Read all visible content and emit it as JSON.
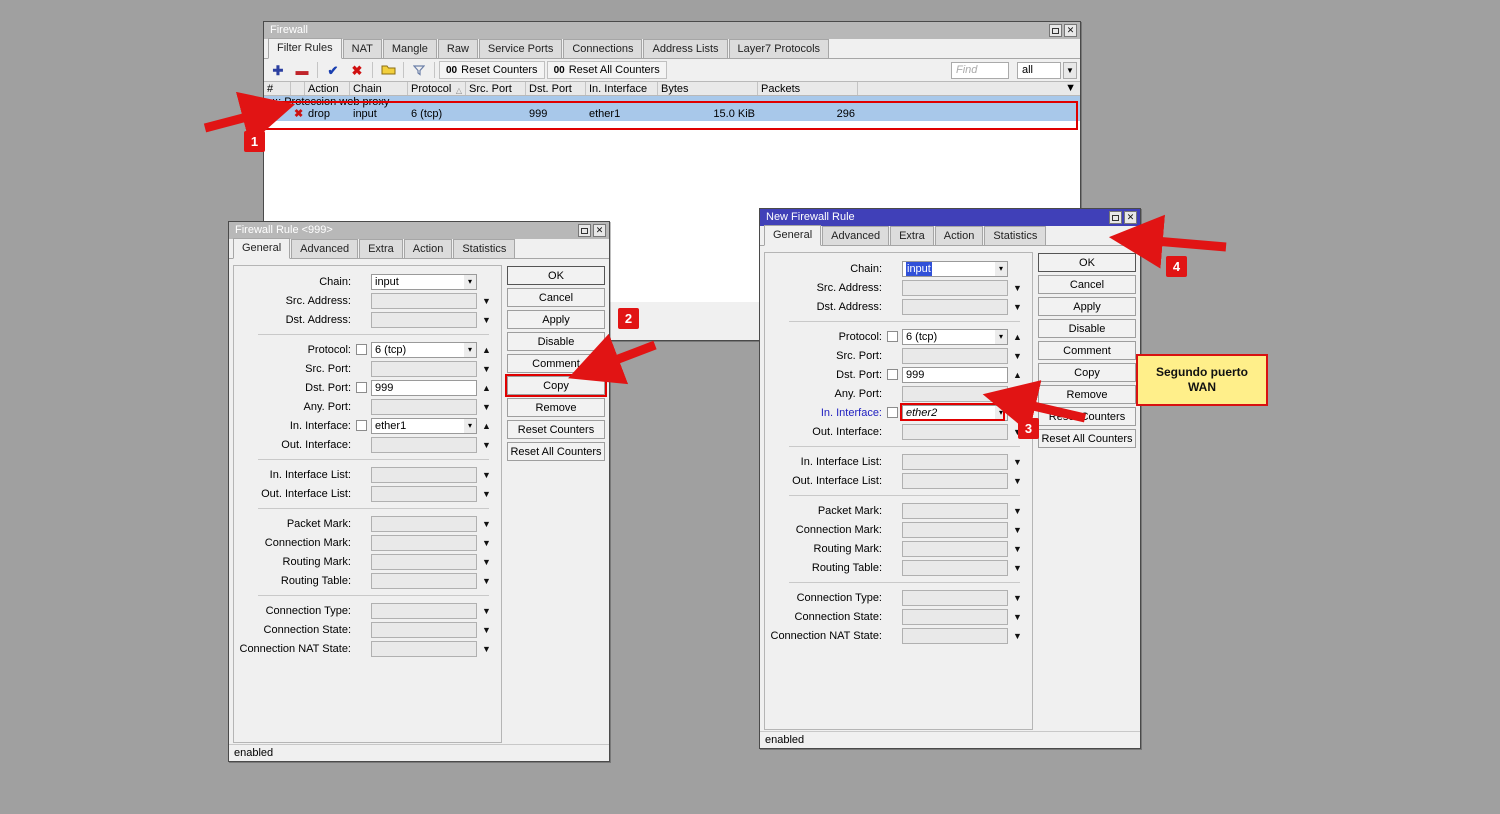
{
  "firewall_window": {
    "title": "Firewall",
    "window_buttons": [
      "maximize-icon",
      "close-icon"
    ],
    "tabs": [
      {
        "label": "Filter Rules",
        "selected": true
      },
      {
        "label": "NAT",
        "selected": false
      },
      {
        "label": "Mangle",
        "selected": false
      },
      {
        "label": "Raw",
        "selected": false
      },
      {
        "label": "Service Ports",
        "selected": false
      },
      {
        "label": "Connections",
        "selected": false
      },
      {
        "label": "Address Lists",
        "selected": false
      },
      {
        "label": "Layer7 Protocols",
        "selected": false
      }
    ],
    "toolbar": {
      "icons": [
        "add-icon",
        "remove-icon",
        "enable-icon",
        "disable-icon",
        "comment-icon",
        "filter-icon"
      ],
      "reset_counters_label": "Reset Counters",
      "reset_all_counters_label": "Reset All Counters",
      "counter_prefix": "00",
      "find_placeholder": "Find",
      "filter_value": "all"
    },
    "columns": [
      "#",
      "Action",
      "Chain",
      "Protocol",
      "Src. Port",
      "Dst. Port",
      "In. Interface",
      "Bytes",
      "Packets"
    ],
    "comment_row": ";;; Proteccion web proxy",
    "rows": [
      {
        "num": "0",
        "action": "drop",
        "chain": "input",
        "protocol": "6 (tcp)",
        "src_port": "",
        "dst_port": "999",
        "in_interface": "ether1",
        "bytes": "15.0 KiB",
        "packets": "296"
      }
    ]
  },
  "left_dialog": {
    "title": "Firewall Rule <999>",
    "tabs": [
      {
        "label": "General",
        "selected": true
      },
      {
        "label": "Advanced",
        "selected": false
      },
      {
        "label": "Extra",
        "selected": false
      },
      {
        "label": "Action",
        "selected": false
      },
      {
        "label": "Statistics",
        "selected": false
      }
    ],
    "fields": [
      {
        "label": "Chain:",
        "value": "input",
        "checkbox": false,
        "drop": "spin",
        "arrow": "none",
        "dim": false,
        "modified": false
      },
      {
        "label": "Src. Address:",
        "value": "",
        "checkbox": false,
        "drop": "none",
        "arrow": "down",
        "dim": true,
        "modified": false
      },
      {
        "label": "Dst. Address:",
        "value": "",
        "checkbox": false,
        "drop": "none",
        "arrow": "down",
        "dim": true,
        "modified": false
      },
      {
        "sep": true
      },
      {
        "label": "Protocol:",
        "value": "6 (tcp)",
        "checkbox": true,
        "drop": "spin",
        "arrow": "up",
        "dim": false,
        "modified": false
      },
      {
        "label": "Src. Port:",
        "value": "",
        "checkbox": false,
        "drop": "none",
        "arrow": "down",
        "dim": true,
        "modified": false
      },
      {
        "label": "Dst. Port:",
        "value": "999",
        "checkbox": true,
        "drop": "none",
        "arrow": "up",
        "dim": false,
        "modified": false
      },
      {
        "label": "Any. Port:",
        "value": "",
        "checkbox": false,
        "drop": "none",
        "arrow": "down",
        "dim": true,
        "modified": false
      },
      {
        "label": "In. Interface:",
        "value": "ether1",
        "checkbox": true,
        "drop": "spin",
        "arrow": "up",
        "dim": false,
        "modified": false
      },
      {
        "label": "Out. Interface:",
        "value": "",
        "checkbox": false,
        "drop": "none",
        "arrow": "down",
        "dim": true,
        "modified": false
      },
      {
        "sep": true
      },
      {
        "label": "In. Interface List:",
        "value": "",
        "checkbox": false,
        "drop": "none",
        "arrow": "down",
        "dim": true,
        "modified": false
      },
      {
        "label": "Out. Interface List:",
        "value": "",
        "checkbox": false,
        "drop": "none",
        "arrow": "down",
        "dim": true,
        "modified": false
      },
      {
        "sep": true
      },
      {
        "label": "Packet Mark:",
        "value": "",
        "checkbox": false,
        "drop": "none",
        "arrow": "down",
        "dim": true,
        "modified": false
      },
      {
        "label": "Connection Mark:",
        "value": "",
        "checkbox": false,
        "drop": "none",
        "arrow": "down",
        "dim": true,
        "modified": false
      },
      {
        "label": "Routing Mark:",
        "value": "",
        "checkbox": false,
        "drop": "none",
        "arrow": "down",
        "dim": true,
        "modified": false
      },
      {
        "label": "Routing Table:",
        "value": "",
        "checkbox": false,
        "drop": "none",
        "arrow": "down",
        "dim": true,
        "modified": false
      },
      {
        "sep": true
      },
      {
        "label": "Connection Type:",
        "value": "",
        "checkbox": false,
        "drop": "none",
        "arrow": "down",
        "dim": true,
        "modified": false
      },
      {
        "label": "Connection State:",
        "value": "",
        "checkbox": false,
        "drop": "none",
        "arrow": "down",
        "dim": true,
        "modified": false
      },
      {
        "label": "Connection NAT State:",
        "value": "",
        "checkbox": false,
        "drop": "none",
        "arrow": "down",
        "dim": true,
        "modified": false
      }
    ],
    "buttons": [
      "OK",
      "Cancel",
      "Apply",
      "Disable",
      "Comment",
      "Copy",
      "Remove",
      "Reset Counters",
      "Reset All Counters"
    ],
    "highlighted_button": "Copy",
    "status": "enabled"
  },
  "right_dialog": {
    "title": "New Firewall Rule",
    "tabs": [
      {
        "label": "General",
        "selected": true
      },
      {
        "label": "Advanced",
        "selected": false
      },
      {
        "label": "Extra",
        "selected": false
      },
      {
        "label": "Action",
        "selected": false
      },
      {
        "label": "Statistics",
        "selected": false
      }
    ],
    "fields": [
      {
        "label": "Chain:",
        "value": "input",
        "checkbox": false,
        "drop": "spin",
        "arrow": "none",
        "dim": false,
        "modified": false,
        "selected_text": true
      },
      {
        "label": "Src. Address:",
        "value": "",
        "checkbox": false,
        "drop": "none",
        "arrow": "down",
        "dim": true,
        "modified": false
      },
      {
        "label": "Dst. Address:",
        "value": "",
        "checkbox": false,
        "drop": "none",
        "arrow": "down",
        "dim": true,
        "modified": false
      },
      {
        "sep": true
      },
      {
        "label": "Protocol:",
        "value": "6 (tcp)",
        "checkbox": true,
        "drop": "spin",
        "arrow": "up",
        "dim": false,
        "modified": false
      },
      {
        "label": "Src. Port:",
        "value": "",
        "checkbox": false,
        "drop": "none",
        "arrow": "down",
        "dim": true,
        "modified": false
      },
      {
        "label": "Dst. Port:",
        "value": "999",
        "checkbox": true,
        "drop": "none",
        "arrow": "up",
        "dim": false,
        "modified": false
      },
      {
        "label": "Any. Port:",
        "value": "",
        "checkbox": false,
        "drop": "none",
        "arrow": "down",
        "dim": true,
        "modified": false
      },
      {
        "label": "In. Interface:",
        "value": "ether2",
        "checkbox": true,
        "drop": "spin",
        "arrow": "up",
        "dim": false,
        "modified": true,
        "highlight": true
      },
      {
        "label": "Out. Interface:",
        "value": "",
        "checkbox": false,
        "drop": "none",
        "arrow": "down",
        "dim": true,
        "modified": false
      },
      {
        "sep": true
      },
      {
        "label": "In. Interface List:",
        "value": "",
        "checkbox": false,
        "drop": "none",
        "arrow": "down",
        "dim": true,
        "modified": false
      },
      {
        "label": "Out. Interface List:",
        "value": "",
        "checkbox": false,
        "drop": "none",
        "arrow": "down",
        "dim": true,
        "modified": false
      },
      {
        "sep": true
      },
      {
        "label": "Packet Mark:",
        "value": "",
        "checkbox": false,
        "drop": "none",
        "arrow": "down",
        "dim": true,
        "modified": false
      },
      {
        "label": "Connection Mark:",
        "value": "",
        "checkbox": false,
        "drop": "none",
        "arrow": "down",
        "dim": true,
        "modified": false
      },
      {
        "label": "Routing Mark:",
        "value": "",
        "checkbox": false,
        "drop": "none",
        "arrow": "down",
        "dim": true,
        "modified": false
      },
      {
        "label": "Routing Table:",
        "value": "",
        "checkbox": false,
        "drop": "none",
        "arrow": "down",
        "dim": true,
        "modified": false
      },
      {
        "sep": true
      },
      {
        "label": "Connection Type:",
        "value": "",
        "checkbox": false,
        "drop": "none",
        "arrow": "down",
        "dim": true,
        "modified": false
      },
      {
        "label": "Connection State:",
        "value": "",
        "checkbox": false,
        "drop": "none",
        "arrow": "down",
        "dim": true,
        "modified": false
      },
      {
        "label": "Connection NAT State:",
        "value": "",
        "checkbox": false,
        "drop": "none",
        "arrow": "down",
        "dim": true,
        "modified": false
      }
    ],
    "buttons": [
      "OK",
      "Cancel",
      "Apply",
      "Disable",
      "Comment",
      "Copy",
      "Remove",
      "Reset Counters",
      "Reset All Counters"
    ],
    "status": "enabled"
  },
  "annotations": {
    "markers": [
      {
        "id": "1",
        "label": "1"
      },
      {
        "id": "2",
        "label": "2"
      },
      {
        "id": "3",
        "label": "3"
      },
      {
        "id": "4",
        "label": "4"
      }
    ],
    "callout": {
      "line1": "Segundo puerto",
      "line2": "WAN"
    },
    "accent_color": "#e11414",
    "callout_bg": "#ffef8a"
  }
}
